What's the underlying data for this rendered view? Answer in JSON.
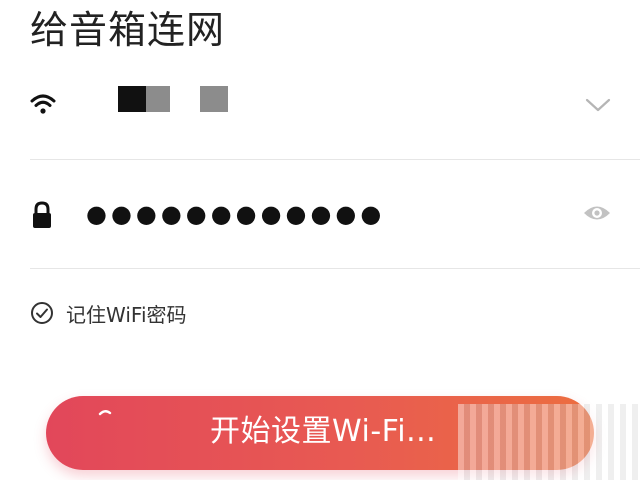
{
  "page": {
    "title": "给音箱连网"
  },
  "wifi": {
    "icon": "wifi-icon",
    "ssid_masked_blocks": [
      "#111111",
      "#8c8c8c",
      "#8c8c8c"
    ],
    "dropdown_icon": "chevron-down-icon"
  },
  "password": {
    "icon": "lock-icon",
    "masked_value": "●●●●●●●●●●●●",
    "visibility_icon": "eye-icon"
  },
  "remember": {
    "icon": "check-circle-icon",
    "label": "记住WiFi密码",
    "checked": true
  },
  "start_button": {
    "label": "开始设置Wi-Fi...",
    "icon": "loading-spinner-icon"
  },
  "colors": {
    "button_gradient_start": "#e2475a",
    "button_gradient_end": "#ec6e3f",
    "divider": "#e6e6e6",
    "icon_gray": "#b5b5b5"
  }
}
